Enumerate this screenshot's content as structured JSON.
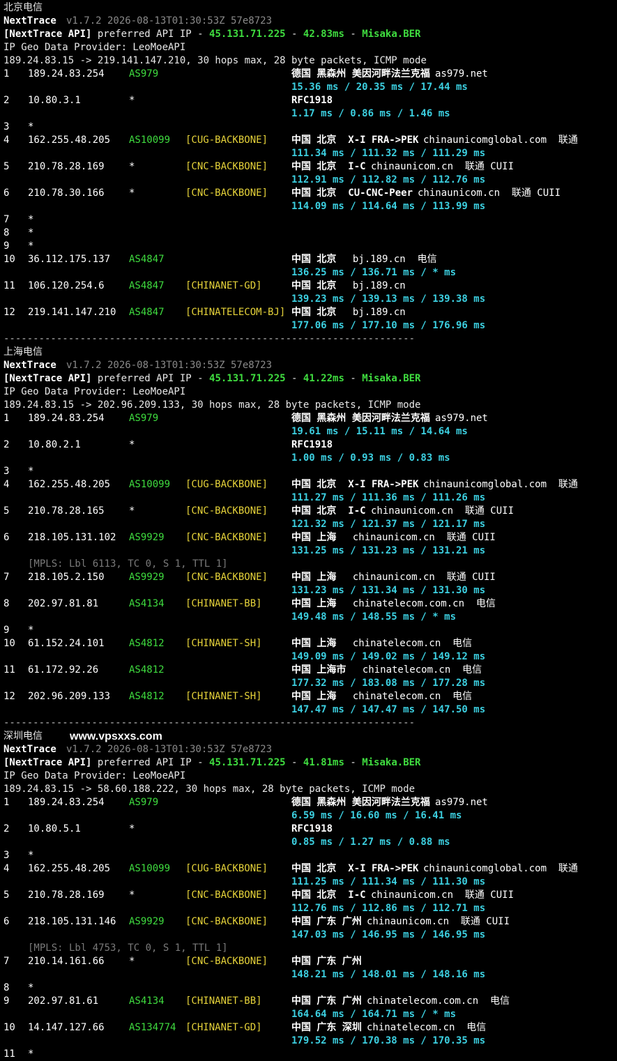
{
  "sections": [
    {
      "title": "北京电信",
      "header": {
        "app": "NextTrace",
        "version": "v1.7.2 2026-08-13T01:30:53Z 57e8723",
        "api_prefix": "[NextTrace API]",
        "api_mid": " preferred API IP - ",
        "api_ip": "45.131.71.225",
        "api_dash1": " - ",
        "api_latency": "42.83ms",
        "api_dash2": " - ",
        "api_node": "Misaka.BER",
        "geo_provider": "IP Geo Data Provider: LeoMoeAPI",
        "route": "189.24.83.15 -> 219.141.147.210, 30 hops max, 28 byte packets, ICMP mode"
      },
      "hops": [
        {
          "num": "1",
          "ip": "189.24.83.254",
          "asn": "AS979",
          "bb": "",
          "geo": "德国 黑森州 美因河畔法兰克福",
          "extra": "as979.net",
          "rtt": "15.36 ms / 20.35 ms / 17.44 ms"
        },
        {
          "num": "2",
          "ip": "10.80.3.1",
          "asn": "*",
          "bb": "",
          "geo": "RFC1918",
          "extra": "",
          "rtt": "1.17 ms / 0.86 ms / 1.46 ms"
        },
        {
          "num": "3",
          "ip": "*"
        },
        {
          "num": "4",
          "ip": "162.255.48.205",
          "asn": "AS10099",
          "bb": "[CUG-BACKBONE]",
          "geo": "中国 北京  X-I FRA->PEK",
          "extra": "chinaunicomglobal.com  联通",
          "rtt": "111.34 ms / 111.32 ms / 111.29 ms"
        },
        {
          "num": "5",
          "ip": "210.78.28.169",
          "asn": "*",
          "bb": "[CNC-BACKBONE]",
          "geo": "中国 北京  I-C",
          "extra": "chinaunicom.cn  联通 CUII",
          "rtt": "112.91 ms / 112.82 ms / 112.76 ms"
        },
        {
          "num": "6",
          "ip": "210.78.30.166",
          "asn": "*",
          "bb": "[CNC-BACKBONE]",
          "geo": "中国 北京  CU-CNC-Peer",
          "extra": "chinaunicom.cn  联通 CUII",
          "rtt": "114.09 ms / 114.64 ms / 113.99 ms"
        },
        {
          "num": "7",
          "ip": "*"
        },
        {
          "num": "8",
          "ip": "*"
        },
        {
          "num": "9",
          "ip": "*"
        },
        {
          "num": "10",
          "ip": "36.112.175.137",
          "asn": "AS4847",
          "bb": "",
          "geo": "中国 北京",
          "extra": "  bj.189.cn  电信",
          "rtt": "136.25 ms / 136.71 ms / * ms"
        },
        {
          "num": "11",
          "ip": "106.120.254.6",
          "asn": "AS4847",
          "bb": "[CHINANET-GD]",
          "geo": "中国 北京",
          "extra": "  bj.189.cn",
          "rtt": "139.23 ms / 139.13 ms / 139.38 ms"
        },
        {
          "num": "12",
          "ip": "219.141.147.210",
          "asn": "AS4847",
          "bb": "[CHINATELECOM-BJ]",
          "geo": "中国 北京",
          "extra": "  bj.189.cn",
          "rtt": "177.06 ms / 177.10 ms / 176.96 ms"
        }
      ]
    },
    {
      "title": "上海电信",
      "header": {
        "app": "NextTrace",
        "version": "v1.7.2 2026-08-13T01:30:53Z 57e8723",
        "api_prefix": "[NextTrace API]",
        "api_mid": " preferred API IP - ",
        "api_ip": "45.131.71.225",
        "api_dash1": " - ",
        "api_latency": "41.22ms",
        "api_dash2": " - ",
        "api_node": "Misaka.BER",
        "geo_provider": "IP Geo Data Provider: LeoMoeAPI",
        "route": "189.24.83.15 -> 202.96.209.133, 30 hops max, 28 byte packets, ICMP mode"
      },
      "hops": [
        {
          "num": "1",
          "ip": "189.24.83.254",
          "asn": "AS979",
          "bb": "",
          "geo": "德国 黑森州 美因河畔法兰克福",
          "extra": "as979.net",
          "rtt": "19.61 ms / 15.11 ms / 14.64 ms"
        },
        {
          "num": "2",
          "ip": "10.80.2.1",
          "asn": "*",
          "bb": "",
          "geo": "RFC1918",
          "extra": "",
          "rtt": "1.00 ms / 0.93 ms / 0.83 ms"
        },
        {
          "num": "3",
          "ip": "*"
        },
        {
          "num": "4",
          "ip": "162.255.48.205",
          "asn": "AS10099",
          "bb": "[CUG-BACKBONE]",
          "geo": "中国 北京  X-I FRA->PEK",
          "extra": "chinaunicomglobal.com  联通",
          "rtt": "111.27 ms / 111.36 ms / 111.26 ms"
        },
        {
          "num": "5",
          "ip": "210.78.28.165",
          "asn": "*",
          "bb": "[CNC-BACKBONE]",
          "geo": "中国 北京  I-C",
          "extra": "chinaunicom.cn  联通 CUII",
          "rtt": "121.32 ms / 121.37 ms / 121.17 ms"
        },
        {
          "num": "6",
          "ip": "218.105.131.102",
          "asn": "AS9929",
          "bb": "[CNC-BACKBONE]",
          "geo": "中国 上海",
          "extra": "  chinaunicom.cn  联通 CUII",
          "rtt": "131.25 ms / 131.23 ms / 131.21 ms",
          "mpls": "[MPLS: Lbl 6113, TC 0, S 1, TTL 1]"
        },
        {
          "num": "7",
          "ip": "218.105.2.150",
          "asn": "AS9929",
          "bb": "[CNC-BACKBONE]",
          "geo": "中国 上海",
          "extra": "  chinaunicom.cn  联通 CUII",
          "rtt": "131.23 ms / 131.34 ms / 131.30 ms"
        },
        {
          "num": "8",
          "ip": "202.97.81.81",
          "asn": "AS4134",
          "bb": "[CHINANET-BB]",
          "geo": "中国 上海",
          "extra": "  chinatelecom.com.cn  电信",
          "rtt": "149.48 ms / 148.55 ms / * ms"
        },
        {
          "num": "9",
          "ip": "*"
        },
        {
          "num": "10",
          "ip": "61.152.24.101",
          "asn": "AS4812",
          "bb": "[CHINANET-SH]",
          "geo": "中国 上海",
          "extra": "  chinatelecom.cn  电信",
          "rtt": "149.09 ms / 149.02 ms / 149.12 ms"
        },
        {
          "num": "11",
          "ip": "61.172.92.26",
          "asn": "AS4812",
          "bb": "",
          "geo": "中国 上海市",
          "extra": "  chinatelecom.cn  电信",
          "rtt": "177.32 ms / 183.08 ms / 177.28 ms"
        },
        {
          "num": "12",
          "ip": "202.96.209.133",
          "asn": "AS4812",
          "bb": "[CHINANET-SH]",
          "geo": "中国 上海",
          "extra": "  chinatelecom.cn  电信",
          "rtt": "147.47 ms / 147.47 ms / 147.50 ms"
        }
      ]
    },
    {
      "title": "深圳电信",
      "watermark": "www.vpsxxs.com",
      "header": {
        "app": "NextTrace",
        "version": "v1.7.2 2026-08-13T01:30:53Z 57e8723",
        "api_prefix": "[NextTrace API]",
        "api_mid": " preferred API IP - ",
        "api_ip": "45.131.71.225",
        "api_dash1": " - ",
        "api_latency": "41.81ms",
        "api_dash2": " - ",
        "api_node": "Misaka.BER",
        "geo_provider": "IP Geo Data Provider: LeoMoeAPI",
        "route": "189.24.83.15 -> 58.60.188.222, 30 hops max, 28 byte packets, ICMP mode"
      },
      "hops": [
        {
          "num": "1",
          "ip": "189.24.83.254",
          "asn": "AS979",
          "bb": "",
          "geo": "德国 黑森州 美因河畔法兰克福",
          "extra": "as979.net",
          "rtt": "6.59 ms / 16.60 ms / 16.41 ms"
        },
        {
          "num": "2",
          "ip": "10.80.5.1",
          "asn": "*",
          "bb": "",
          "geo": "RFC1918",
          "extra": "",
          "rtt": "0.85 ms / 1.27 ms / 0.88 ms"
        },
        {
          "num": "3",
          "ip": "*"
        },
        {
          "num": "4",
          "ip": "162.255.48.205",
          "asn": "AS10099",
          "bb": "[CUG-BACKBONE]",
          "geo": "中国 北京  X-I FRA->PEK",
          "extra": "chinaunicomglobal.com  联通",
          "rtt": "111.25 ms / 111.34 ms / 111.30 ms"
        },
        {
          "num": "5",
          "ip": "210.78.28.169",
          "asn": "*",
          "bb": "[CNC-BACKBONE]",
          "geo": "中国 北京  I-C",
          "extra": "chinaunicom.cn  联通 CUII",
          "rtt": "112.76 ms / 112.86 ms / 112.71 ms"
        },
        {
          "num": "6",
          "ip": "218.105.131.146",
          "asn": "AS9929",
          "bb": "[CNC-BACKBONE]",
          "geo": "中国 广东 广州",
          "extra": "chinaunicom.cn  联通 CUII",
          "rtt": "147.03 ms / 146.95 ms / 146.95 ms",
          "mpls": "[MPLS: Lbl 4753, TC 0, S 1, TTL 1]"
        },
        {
          "num": "7",
          "ip": "210.14.161.66",
          "asn": "*",
          "bb": "[CNC-BACKBONE]",
          "geo": "中国 广东 广州",
          "extra": "",
          "rtt": "148.21 ms / 148.01 ms / 148.16 ms"
        },
        {
          "num": "8",
          "ip": "*"
        },
        {
          "num": "9",
          "ip": "202.97.81.61",
          "asn": "AS4134",
          "bb": "[CHINANET-BB]",
          "geo": "中国 广东 广州",
          "extra": "chinatelecom.com.cn  电信",
          "rtt": "164.64 ms / 164.71 ms / * ms"
        },
        {
          "num": "10",
          "ip": "14.147.127.66",
          "asn": "AS134774",
          "bb": "[CHINANET-GD]",
          "geo": "中国 广东 深圳",
          "extra": "chinatelecom.cn  电信",
          "rtt": "179.52 ms / 170.38 ms / 170.35 ms"
        },
        {
          "num": "11",
          "ip": "*"
        }
      ]
    }
  ],
  "separator": "----------------------------------------------------------------------"
}
